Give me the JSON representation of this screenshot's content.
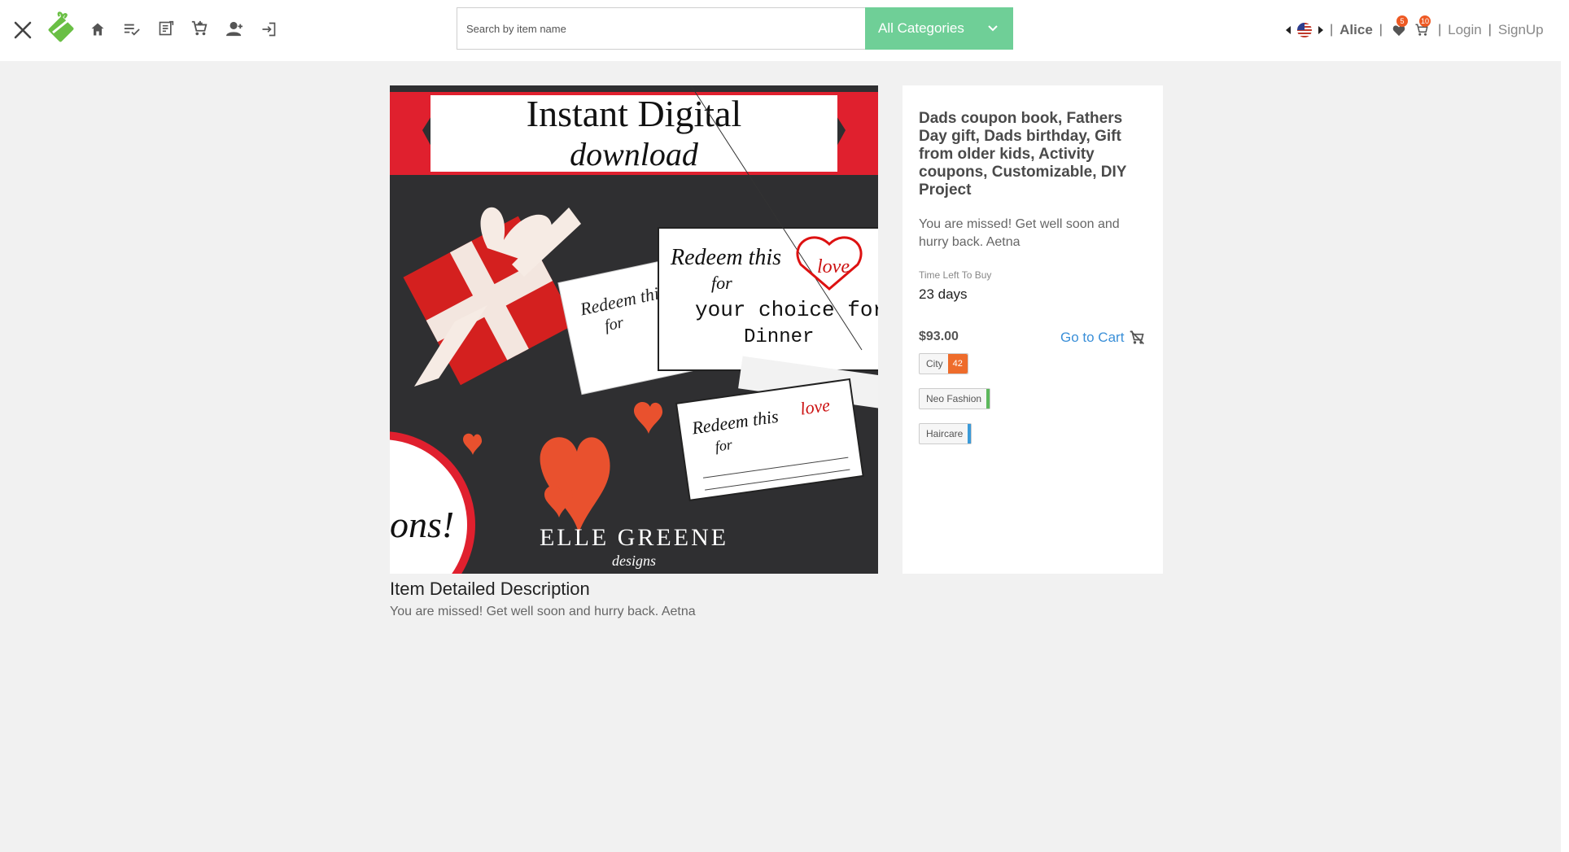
{
  "header": {
    "search_placeholder": "Search by item name",
    "category_label": "All Categories",
    "user_name": "Alice",
    "wishlist_count": "5",
    "cart_count": "10",
    "login_label": "Login",
    "signup_label": "SignUp",
    "separator": "|",
    "icons": [
      "close-icon",
      "gift-logo-icon",
      "home-icon",
      "list-check-icon",
      "note-icon",
      "cart-add-icon",
      "person-add-icon",
      "login-icon"
    ]
  },
  "product": {
    "image_text": {
      "banner_line1": "Instant Digital",
      "banner_line2": "download",
      "card1_line1": "Redeem this",
      "card1_line2": "for",
      "card1_line3": "your choice for",
      "card1_line4": "Dinner",
      "card_small": "Redeem this",
      "card_small2": "for",
      "love": "love",
      "brand": "ELLE GREENE",
      "brand_sub": "designs",
      "circle_text": "ons!"
    },
    "title": "Dads coupon book, Fathers Day gift, Dads birthday, Gift from older kids, Activity coupons, Customizable, DIY Project",
    "short_description": "You are missed! Get well soon and hurry back. Aetna",
    "time_label": "Time Left To Buy",
    "time_value": "23 days",
    "price": "$93.00",
    "go_to_cart": "Go to Cart",
    "tags": [
      {
        "label": "City",
        "count": "42",
        "color": "#ee6c2b"
      },
      {
        "label": "Neo Fashion",
        "count": "",
        "color": "#5cb85c"
      },
      {
        "label": "Haircare",
        "count": "",
        "color": "#3a9ad9"
      }
    ],
    "detail_heading": "Item Detailed Description",
    "detail_text": "You are missed! Get well soon and hurry back. Aetna"
  },
  "colors": {
    "accent_green": "#6fcf97",
    "logo_green": "#6abf45",
    "link_blue": "#3a8fd8",
    "badge_orange": "#ee5a24"
  }
}
